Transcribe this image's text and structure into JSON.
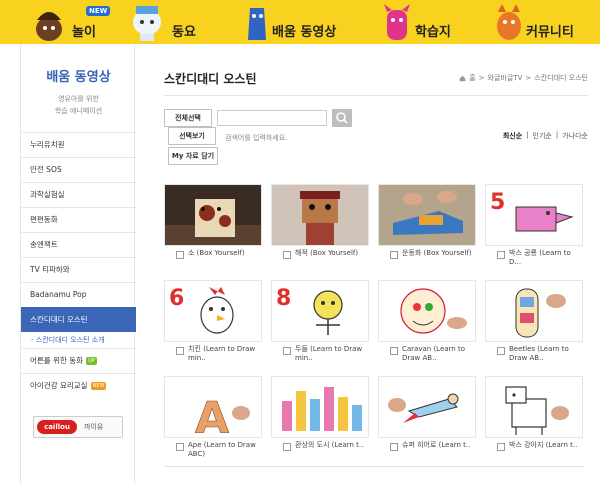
{
  "nav": {
    "new_badge": "NEW",
    "items": [
      {
        "label": "놀이"
      },
      {
        "label": "동요"
      },
      {
        "label": "배움 동영상"
      },
      {
        "label": "학습지"
      },
      {
        "label": "커뮤니티"
      }
    ]
  },
  "sidebar": {
    "title": "배움 동영상",
    "subtitle1": "영유아를 위한",
    "subtitle2": "학습 애니메이션",
    "items": [
      {
        "label": "누리유치원"
      },
      {
        "label": "안전 SOS"
      },
      {
        "label": "과학실험실"
      },
      {
        "label": "편편동화"
      },
      {
        "label": "송엔잭트"
      },
      {
        "label": "TV 티파하와"
      },
      {
        "label": "Badanamu Pop"
      },
      {
        "label": "스칸디대디 오스틴"
      }
    ],
    "subitem": "- 스칸디대디 오스틴 소개",
    "items_after": [
      {
        "label": "어른를 위한 동화",
        "tag": "UP"
      },
      {
        "label": "아이건강 요리교실",
        "tag": "NEW"
      }
    ],
    "caillou_logo": "caillou",
    "caillou_label": "까이유"
  },
  "main": {
    "title": "스칸디대디 오스틴",
    "breadcrumb": [
      "홈",
      ">",
      "와글바글TV",
      ">",
      "스칸디대디 오스틴"
    ],
    "buttons": {
      "select_all": "전체선택",
      "select_view": "선택보기",
      "my_save": "My 자료 담기"
    },
    "search": {
      "placeholder": "",
      "hint": "검색어를 입력하세요."
    },
    "sort": [
      "최신순",
      "인기순",
      "가나다순"
    ],
    "cards": [
      {
        "title": "소 (Box Yourself)"
      },
      {
        "title": "해적 (Box Yourself)"
      },
      {
        "title": "운동화 (Box Yourself)"
      },
      {
        "title": "박스 공룡 (Learn to D..."
      },
      {
        "title": "치킨 (Learn to Draw min.."
      },
      {
        "title": "두들 (Learn to Draw min.."
      },
      {
        "title": "Caravan (Learn to Draw AB.."
      },
      {
        "title": "Beetles (Learn to Draw AB.."
      },
      {
        "title": "Ape (Learn to Draw ABC)"
      },
      {
        "title": "환상의 도시 (Learn t.."
      },
      {
        "title": "슈퍼 히어로 (Learn t.."
      },
      {
        "title": "박스 강아지 (Learn t.."
      }
    ],
    "thumb_numbers": [
      "5",
      "6",
      "8"
    ],
    "thumb_letter": "A"
  }
}
